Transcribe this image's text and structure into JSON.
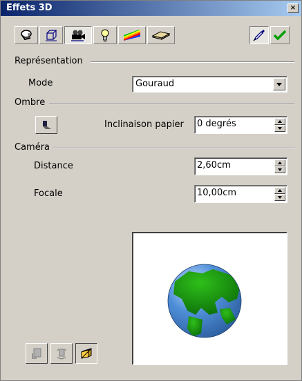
{
  "window": {
    "title": "Effets 3D",
    "close_glyph": "×"
  },
  "toolbar": {
    "buttons": [
      {
        "icon": "geometry-icon",
        "tooltip": ""
      },
      {
        "icon": "shading-cube-icon",
        "tooltip": ""
      },
      {
        "icon": "camera-icon",
        "tooltip": ""
      },
      {
        "icon": "lightbulb-icon",
        "tooltip": ""
      },
      {
        "icon": "textures-rainbow-icon",
        "tooltip": ""
      },
      {
        "icon": "material-icon",
        "tooltip": ""
      }
    ],
    "assign_icon": "pipette-icon",
    "apply_icon": "checkmark-icon"
  },
  "representation": {
    "section": "Représentation",
    "mode_label": "Mode",
    "mode_value": "Gouraud"
  },
  "shadow": {
    "section": "Ombre",
    "tilt_label": "Inclinaison papier",
    "tilt_value": "0 degrés"
  },
  "camera": {
    "section": "Caméra",
    "distance_label": "Distance",
    "distance_value": "2,60cm",
    "focal_label": "Focale",
    "focal_value": "10,00cm"
  },
  "colors": {
    "titlebar_start": "#0a246a",
    "titlebar_end": "#a6caf0",
    "globe_ocean": "#4f8fd8",
    "globe_land": "#1e8a10"
  }
}
